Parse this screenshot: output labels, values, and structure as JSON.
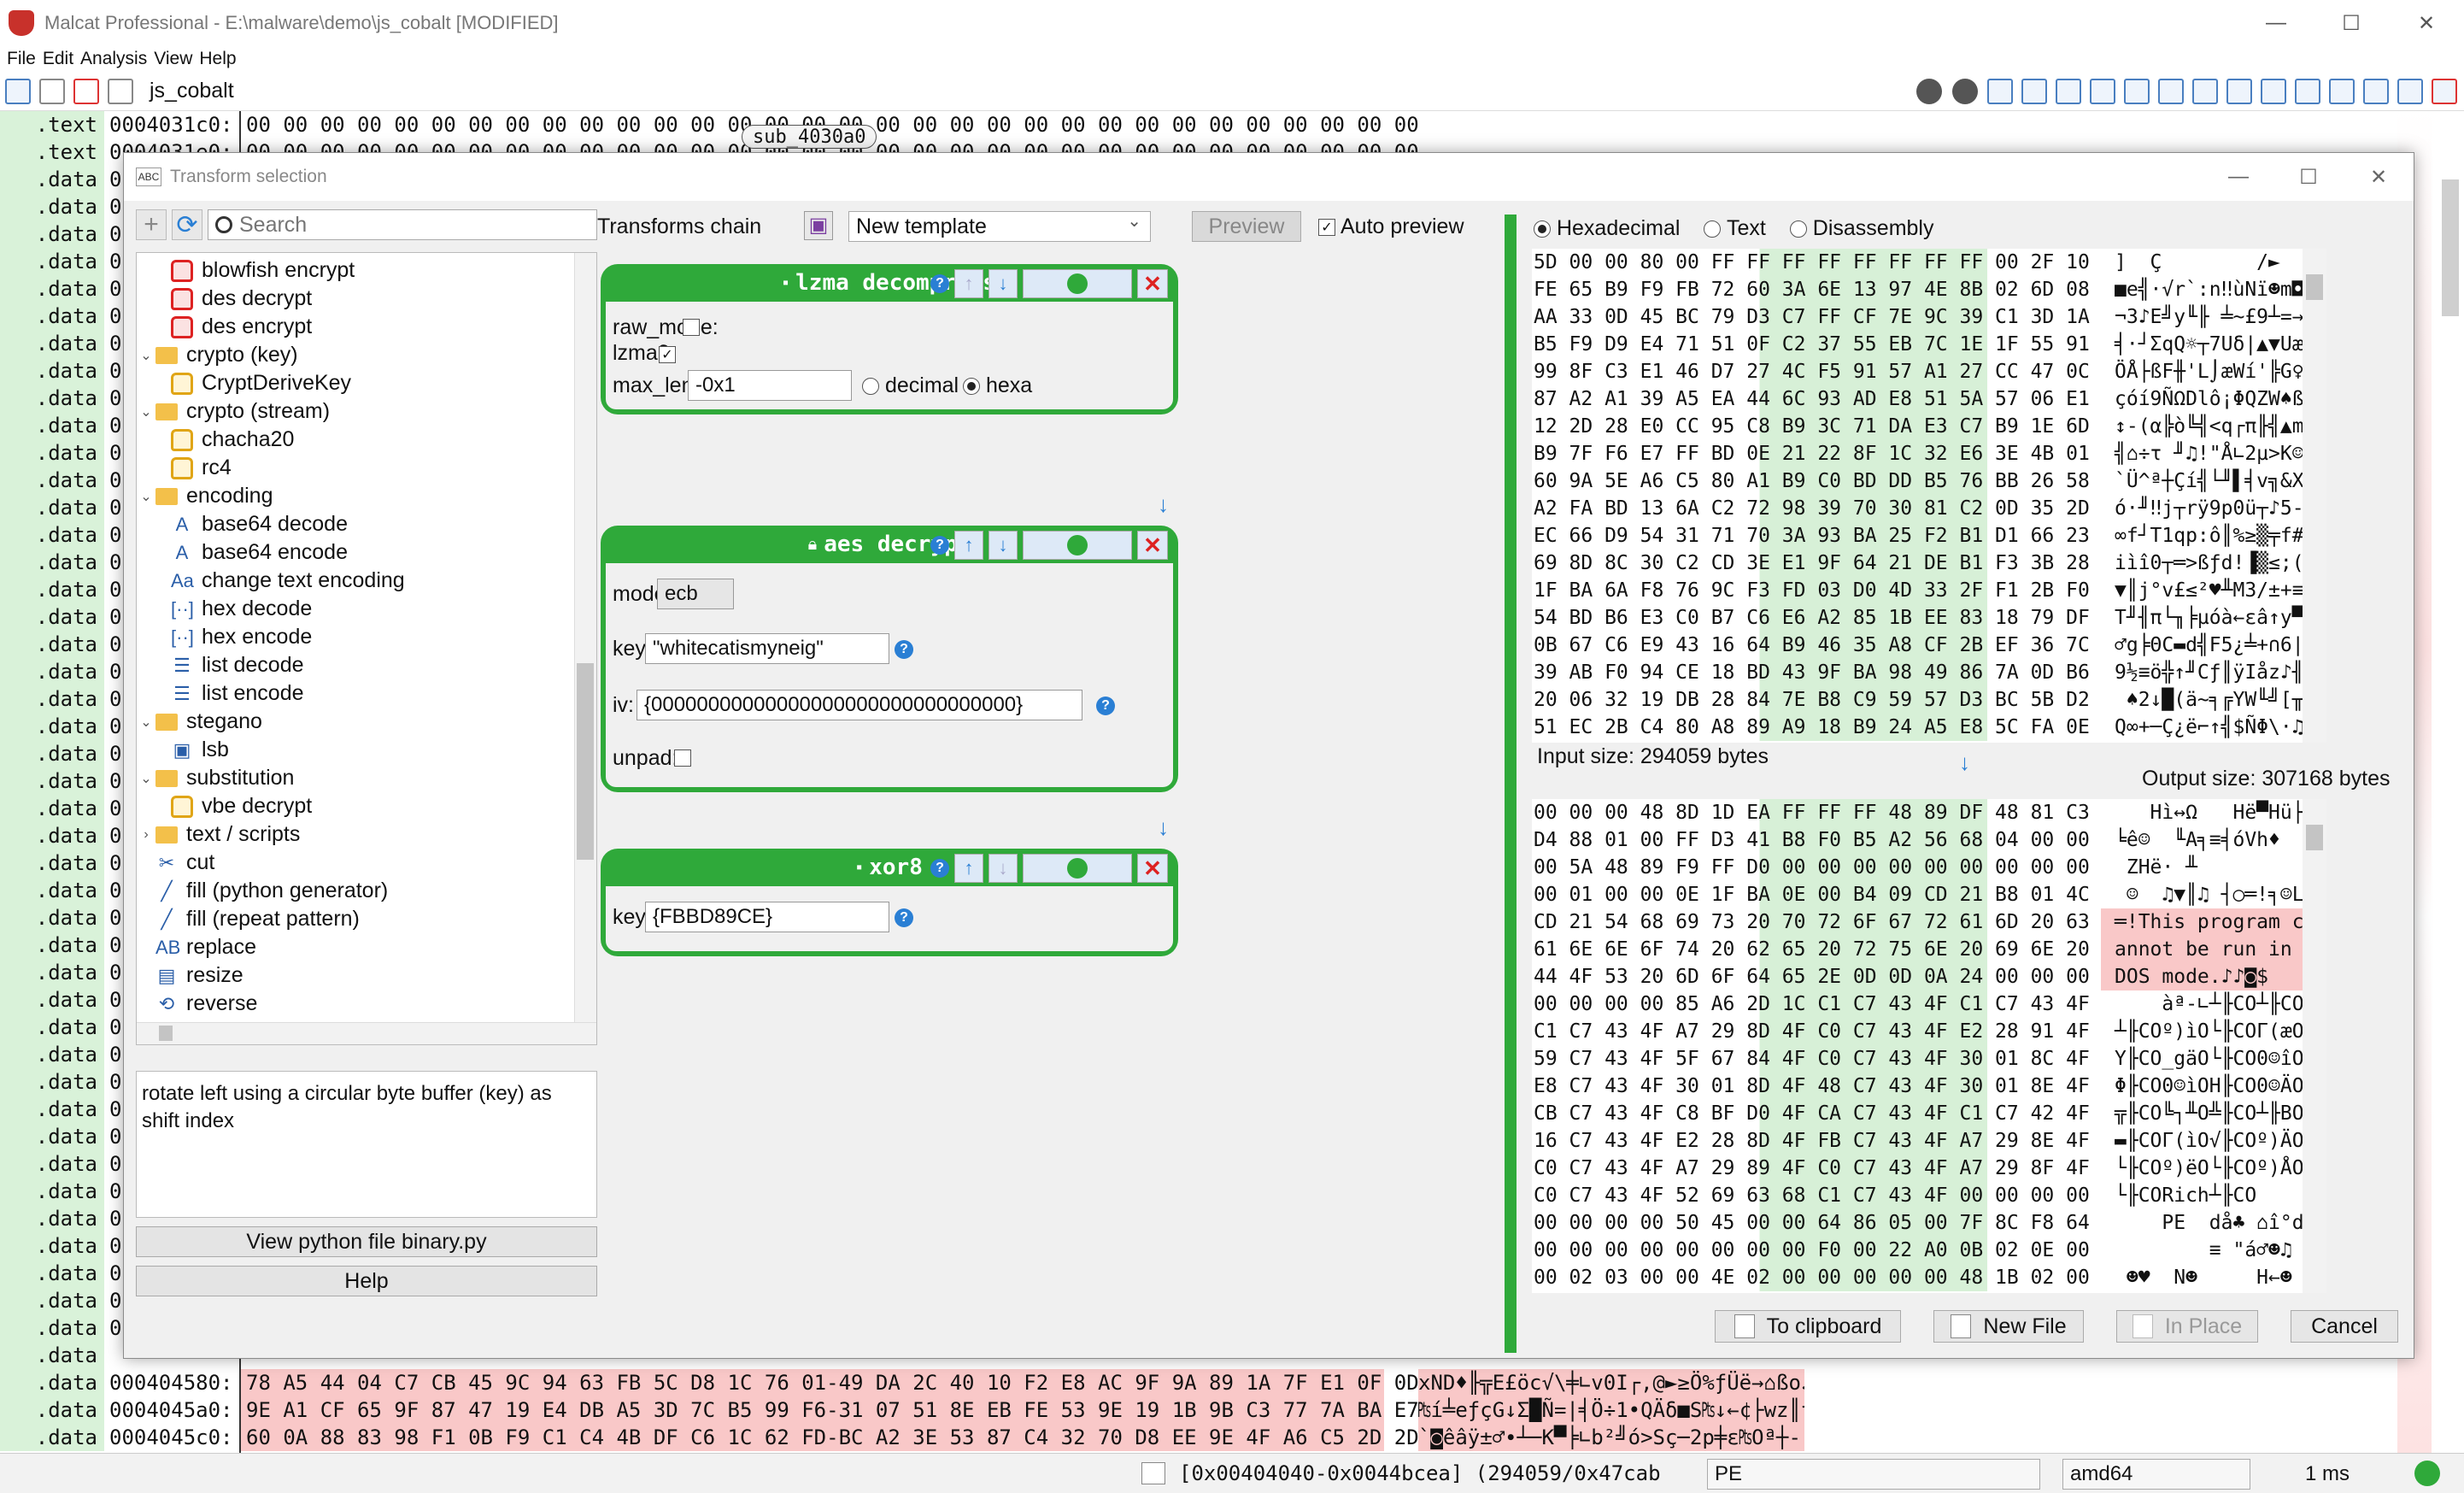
{
  "window": {
    "title": "Malcat Professional - E:\\malware\\demo\\js_cobalt  [MODIFIED]",
    "min": "—",
    "max": "☐",
    "close": "✕"
  },
  "menu": [
    "File",
    "Edit",
    "Analysis",
    "View",
    "Help"
  ],
  "tab": {
    "label": "js_cobalt"
  },
  "sections": [
    ".text",
    ".text",
    ".data",
    ".data",
    ".data",
    ".data",
    ".data",
    ".data",
    ".data",
    ".data",
    ".data",
    ".data",
    ".data",
    ".data",
    ".data",
    ".data",
    ".data",
    ".data",
    ".data",
    ".data",
    ".data",
    ".data",
    ".data",
    ".data",
    ".data",
    ".data",
    ".data",
    ".data",
    ".data",
    ".data",
    ".data",
    ".data",
    ".data",
    ".data",
    ".data",
    ".data",
    ".data",
    ".data",
    ".data",
    ".data",
    ".data",
    ".data",
    ".data",
    ".data",
    ".data",
    ".data",
    ".data",
    ".data",
    ".data"
  ],
  "bg": {
    "top_rows": [
      {
        "addr": "0004031c0:",
        "hex": "00 00 00 00 00 00 00 00 00 00 00 00 00 00 00 00 00 00 00 00 00 00 00 00 00 00 00 00 00 00 00 00"
      },
      {
        "addr": "0004031e0:",
        "hex": "00 00 00 00 00 00 00 00 00 00 00 00 00 00 00 00 00 00 00 00 00 00 00 00 00 00 00 00 00 00 00 00"
      }
    ],
    "sub_label": "sub_4030a0",
    "addr_stub": "00",
    "bottom_rows": [
      {
        "addr": "000404580:",
        "hex": "78 A5 44 04 C7 CB 45 9C 94 63 FB 5C D8 1C 76 01-49 DA 2C 40 10 F2 E8 AC 9F 9A 89 1A 7F E1 0F 0D",
        "ascii": "xND♦╟╦E£öc√\\╪∟v0I┌,@►≥Ö%ƒÜë→⌂ßo♪"
      },
      {
        "addr": "0004045a0:",
        "hex": "9E A1 CF 65 9F 87 47 19 E4 DB A5 3D 7C B5 99 F6-31 07 51 8E EB FE 53 9E 19 1B 9B C3 77 7A BA E7",
        "ascii": "₧í╧eƒçG↓Σ█Ñ=|╡Ö÷1•QÄδ■S₧↓←¢├wz║τ"
      },
      {
        "addr": "0004045c0:",
        "hex": "60 0A 88 83 98 F1 0B F9 C1 C4 4B DF C6 1C 62 FD-BC A2 3E 53 87 C4 32 70 D8 EE 9E 4F A6 C5 2D 2D",
        "ascii": "`◙êâÿ±♂∙┴─K▀╞∟b²╝ó>Sç─2p╪ε₧Oª┼--"
      }
    ]
  },
  "status": {
    "range": "[0x00404040-0x0044bcea] (294059/0x47cab",
    "format": "PE",
    "arch": "amd64",
    "time": "1 ms"
  },
  "dialog": {
    "title": "Transform selection",
    "title_icon": "ABC",
    "search": {
      "placeholder": "Search",
      "value": ""
    },
    "tree": [
      {
        "label": "blowfish encrypt",
        "icon": "lock-red",
        "level": 1
      },
      {
        "label": "des decrypt",
        "icon": "lock-red",
        "level": 1
      },
      {
        "label": "des encrypt",
        "icon": "lock-red",
        "level": 1
      },
      {
        "label": "crypto (key)",
        "icon": "folder",
        "level": 0,
        "expander": "⌄"
      },
      {
        "label": "CryptDeriveKey",
        "icon": "lock-gold",
        "level": 1
      },
      {
        "label": "crypto (stream)",
        "icon": "folder",
        "level": 0,
        "expander": "⌄"
      },
      {
        "label": "chacha20",
        "icon": "lock-gold",
        "level": 1
      },
      {
        "label": "rc4",
        "icon": "lock-gold",
        "level": 1
      },
      {
        "label": "encoding",
        "icon": "folder",
        "level": 0,
        "expander": "⌄"
      },
      {
        "label": "base64 decode",
        "icon": "glyph",
        "glyph": "A",
        "level": 1
      },
      {
        "label": "base64 encode",
        "icon": "glyph",
        "glyph": "A",
        "level": 1
      },
      {
        "label": "change text encoding",
        "icon": "glyph",
        "glyph": "Aa",
        "level": 1
      },
      {
        "label": "hex decode",
        "icon": "glyph",
        "glyph": "[··]",
        "level": 1
      },
      {
        "label": "hex encode",
        "icon": "glyph",
        "glyph": "[··]",
        "level": 1
      },
      {
        "label": "list decode",
        "icon": "glyph",
        "glyph": "☰",
        "level": 1
      },
      {
        "label": "list encode",
        "icon": "glyph",
        "glyph": "☰",
        "level": 1
      },
      {
        "label": "stegano",
        "icon": "folder",
        "level": 0,
        "expander": "⌄"
      },
      {
        "label": "lsb",
        "icon": "glyph",
        "glyph": "▣",
        "level": 1
      },
      {
        "label": "substitution",
        "icon": "folder",
        "level": 0,
        "expander": "⌄"
      },
      {
        "label": "vbe decrypt",
        "icon": "lock-gold",
        "level": 1
      },
      {
        "label": "text / scripts",
        "icon": "folder",
        "level": 0,
        "expander": "›"
      },
      {
        "label": "cut",
        "icon": "glyph",
        "glyph": "✂",
        "level": 0
      },
      {
        "label": "fill (python generator)",
        "icon": "glyph",
        "glyph": "╱",
        "level": 0
      },
      {
        "label": "fill (repeat pattern)",
        "icon": "glyph",
        "glyph": "╱",
        "level": 0
      },
      {
        "label": "replace",
        "icon": "glyph",
        "glyph": "AB",
        "level": 0
      },
      {
        "label": "resize",
        "icon": "glyph",
        "glyph": "▤",
        "level": 0
      },
      {
        "label": "reverse",
        "icon": "glyph",
        "glyph": "⟲",
        "level": 0
      }
    ],
    "description": "rotate left using a circular byte buffer (key) as shift index",
    "view_python_label": "View python file binary.py",
    "help_label": "Help",
    "chain_label": "Transforms chain",
    "template": "New template",
    "preview_label": "Preview",
    "auto_preview_label": "Auto preview",
    "auto_preview": true,
    "transforms": [
      {
        "name": "lzma decompress",
        "fields": [
          {
            "label": "raw_mode:",
            "type": "check",
            "checked": false
          },
          {
            "label": "lzma2:",
            "type": "check",
            "checked": true
          },
          {
            "label": "max_length:",
            "type": "text",
            "value": "-0x1",
            "radios": [
              {
                "label": "decimal",
                "on": false
              },
              {
                "label": "hexa",
                "on": true
              }
            ]
          }
        ]
      },
      {
        "name": "aes decrypt",
        "fields": [
          {
            "label": "mode:",
            "type": "select",
            "value": "ecb"
          },
          {
            "label": "key:",
            "type": "text",
            "value": "\"whitecatismyneig\""
          },
          {
            "label": "iv:",
            "type": "text",
            "value": "{00000000000000000000000000000000}"
          },
          {
            "label": "unpad:",
            "type": "check",
            "checked": false
          }
        ]
      },
      {
        "name": "xor8",
        "fields": [
          {
            "label": "key:",
            "type": "text",
            "value": "{FBBD89CE}"
          }
        ]
      }
    ],
    "format": {
      "options": [
        "Hexadecimal",
        "Text",
        "Disassembly"
      ],
      "selected": "Hexadecimal"
    },
    "input": {
      "size_label": "Input size: 294059 bytes",
      "rows": [
        {
          "hex": "5D 00 00 80 00 FF FF FF FF FF FF FF FF 00 2F 10",
          "ascii": "]  Ç        /►"
        },
        {
          "hex": "FE 65 B9 F9 FB 72 60 3A 6E 13 97 4E 8B 02 6D 08",
          "ascii": "■e╣·√r`:n‼ùNï☻m◘"
        },
        {
          "hex": "AA 33 0D 45 BC 79 D3 C7 FF CF 7E 9C 39 C1 3D 1A",
          "ascii": "¬3♪E╝y╙╟ ╧~£9┴=→"
        },
        {
          "hex": "B5 F9 D9 E4 71 51 0F C2 37 55 EB 7C 1E 1F 55 91",
          "ascii": "╡·┘ΣqQ☼┬7Uδ|▲▼Uæ"
        },
        {
          "hex": "99 8F C3 E1 46 D7 27 4C F5 91 57 A1 27 CC 47 0C",
          "ascii": "ÖÅ├ßF╫'L⌡æWí'╠G♀"
        },
        {
          "hex": "87 A2 A1 39 A5 EA 44 6C 93 AD E8 51 5A 57 06 E1",
          "ascii": "çóí9ÑΩDlô¡ΦQZW♠ß"
        },
        {
          "hex": "12 2D 28 E0 CC 95 C8 B9 3C 71 DA E3 C7 B9 1E 6D",
          "ascii": "↕-(α╠ò╚╣<q┌π╟╣▲m"
        },
        {
          "hex": "B9 7F F6 E7 FF BD 0E 21 22 8F 1C 32 E6 3E 4B 01",
          "ascii": "╣⌂÷τ ╜♫!\"Å∟2µ>K☺"
        },
        {
          "hex": "60 9A 5E A6 C5 80 A1 B9 C0 BD DD B5 76 BB 26 58",
          "ascii": "`Ü^ª┼Çí╣└╜▌╡v╗&X"
        },
        {
          "hex": "A2 FA BD 13 6A C2 72 98 39 70 30 81 C2 0D 35 2D",
          "ascii": "ó·╜‼j┬rÿ9p0ü┬♪5-"
        },
        {
          "hex": "EC 66 D9 54 31 71 70 3A 93 BA 25 F2 B1 D1 66 23",
          "ascii": "∞f┘T1qp:ô║%≥▒╤f#"
        },
        {
          "hex": "69 8D 8C 30 C2 CD 3E E1 9F 64 21 DE B1 F3 3B 28",
          "ascii": "iìî0┬═>ßƒd!▐▒≤;("
        },
        {
          "hex": "1F BA 6A F8 76 9C F3 FD 03 D0 4D 33 2F F1 2B F0",
          "ascii": "▼║j°v£≤²♥╨M3/±+≡"
        },
        {
          "hex": "54 BD B6 E3 C0 B7 C6 E6 A2 85 1B EE 83 18 79 DF",
          "ascii": "T╜╢π└╖╞µóà←εâ↑y▀"
        },
        {
          "hex": "0B 67 C6 E9 43 16 64 B9 46 35 A8 CF 2B EF 36 7C",
          "ascii": "♂g╞ΘC▬d╣F5¿╧+∩6|"
        },
        {
          "hex": "39 AB F0 94 CE 18 BD 43 9F BA 98 49 86 7A 0D B6",
          "ascii": "9½≡ö╬↑╜Cƒ║ÿIåz♪╢"
        },
        {
          "hex": "20 06 32 19 DB 28 84 7E B8 C9 59 57 D3 BC 5B D2",
          "ascii": " ♠2↓█(ä~╕╔YW╙╝[╥"
        },
        {
          "hex": "51 EC 2B C4 80 A8 89 A9 18 B9 24 A5 E8 5C FA 0E",
          "ascii": "Q∞+─Ç¿ë⌐↑╣$ÑΦ\\·♫"
        }
      ]
    },
    "output": {
      "size_label": "Output size: 307168 bytes",
      "rows": [
        {
          "hex": "00 00 00 48 8D 1D EA FF FF FF 48 89 DF 48 81 C3",
          "ascii": "   Hì↔Ω   Hë▀Hü├"
        },
        {
          "hex": "D4 88 01 00 FF D3 41 B8 F0 B5 A2 56 68 04 00 00",
          "ascii": "╘ê☺  ╙A╕≡╡óVh♦  "
        },
        {
          "hex": "00 5A 48 89 F9 FF D0 00 00 00 00 00 00 00 00 00",
          "ascii": " ZHë· ╨         "
        },
        {
          "hex": "00 01 00 00 0E 1F BA 0E 00 B4 09 CD 21 B8 01 4C",
          "ascii": " ☺  ♫▼║♫ ┤○═!╕☺L"
        },
        {
          "hex": "CD 21 54 68 69 73 20 70 72 6F 67 72 61 6D 20 63",
          "ascii": "═!This program c"
        },
        {
          "hex": "61 6E 6E 6F 74 20 62 65 20 72 75 6E 20 69 6E 20",
          "ascii": "annot be run in "
        },
        {
          "hex": "44 4F 53 20 6D 6F 64 65 2E 0D 0D 0A 24 00 00 00",
          "ascii": "DOS mode.♪♪◙$   "
        },
        {
          "hex": "00 00 00 00 85 A6 2D 1C C1 C7 43 4F C1 C7 43 4F",
          "ascii": "    àª-∟┴╟CO┴╟CO"
        },
        {
          "hex": "C1 C7 43 4F A7 29 8D 4F C0 C7 43 4F E2 28 91 4F",
          "ascii": "┴╟COº)ìO└╟COΓ(æO"
        },
        {
          "hex": "59 C7 43 4F 5F 67 84 4F C0 C7 43 4F 30 01 8C 4F",
          "ascii": "Y╟CO_gäO└╟CO0☺îO"
        },
        {
          "hex": "E8 C7 43 4F 30 01 8D 4F 48 C7 43 4F 30 01 8E 4F",
          "ascii": "Φ╟CO0☺ìOH╟CO0☺ÄO"
        },
        {
          "hex": "CB C7 43 4F C8 BF D0 4F CA C7 43 4F C1 C7 42 4F",
          "ascii": "╦╟CO╚┐╨O╩╟CO┴╟BO"
        },
        {
          "hex": "16 C7 43 4F E2 28 8D 4F FB C7 43 4F A7 29 8E 4F",
          "ascii": "▬╟COΓ(ìO√╟COº)ÄO"
        },
        {
          "hex": "C0 C7 43 4F A7 29 89 4F C0 C7 43 4F A7 29 8F 4F",
          "ascii": "└╟COº)ëO└╟COº)ÅO"
        },
        {
          "hex": "C0 C7 43 4F 52 69 63 68 C1 C7 43 4F 00 00 00 00",
          "ascii": "└╟CORich┴╟CO    "
        },
        {
          "hex": "00 00 00 00 50 45 00 00 64 86 05 00 7F 8C F8 64",
          "ascii": "    PE  då♣ ⌂î°d"
        },
        {
          "hex": "00 00 00 00 00 00 00 00 F0 00 22 A0 0B 02 0E 00",
          "ascii": "        ≡ \"á♂☻♫ "
        },
        {
          "hex": "00 02 03 00 00 4E 02 00 00 00 00 00 48 1B 02 00",
          "ascii": " ☻♥  N☻     H←☻ "
        }
      ]
    },
    "buttons": {
      "clipboard": "To clipboard",
      "new_file": "New File",
      "in_place": "In Place",
      "cancel": "Cancel"
    }
  }
}
